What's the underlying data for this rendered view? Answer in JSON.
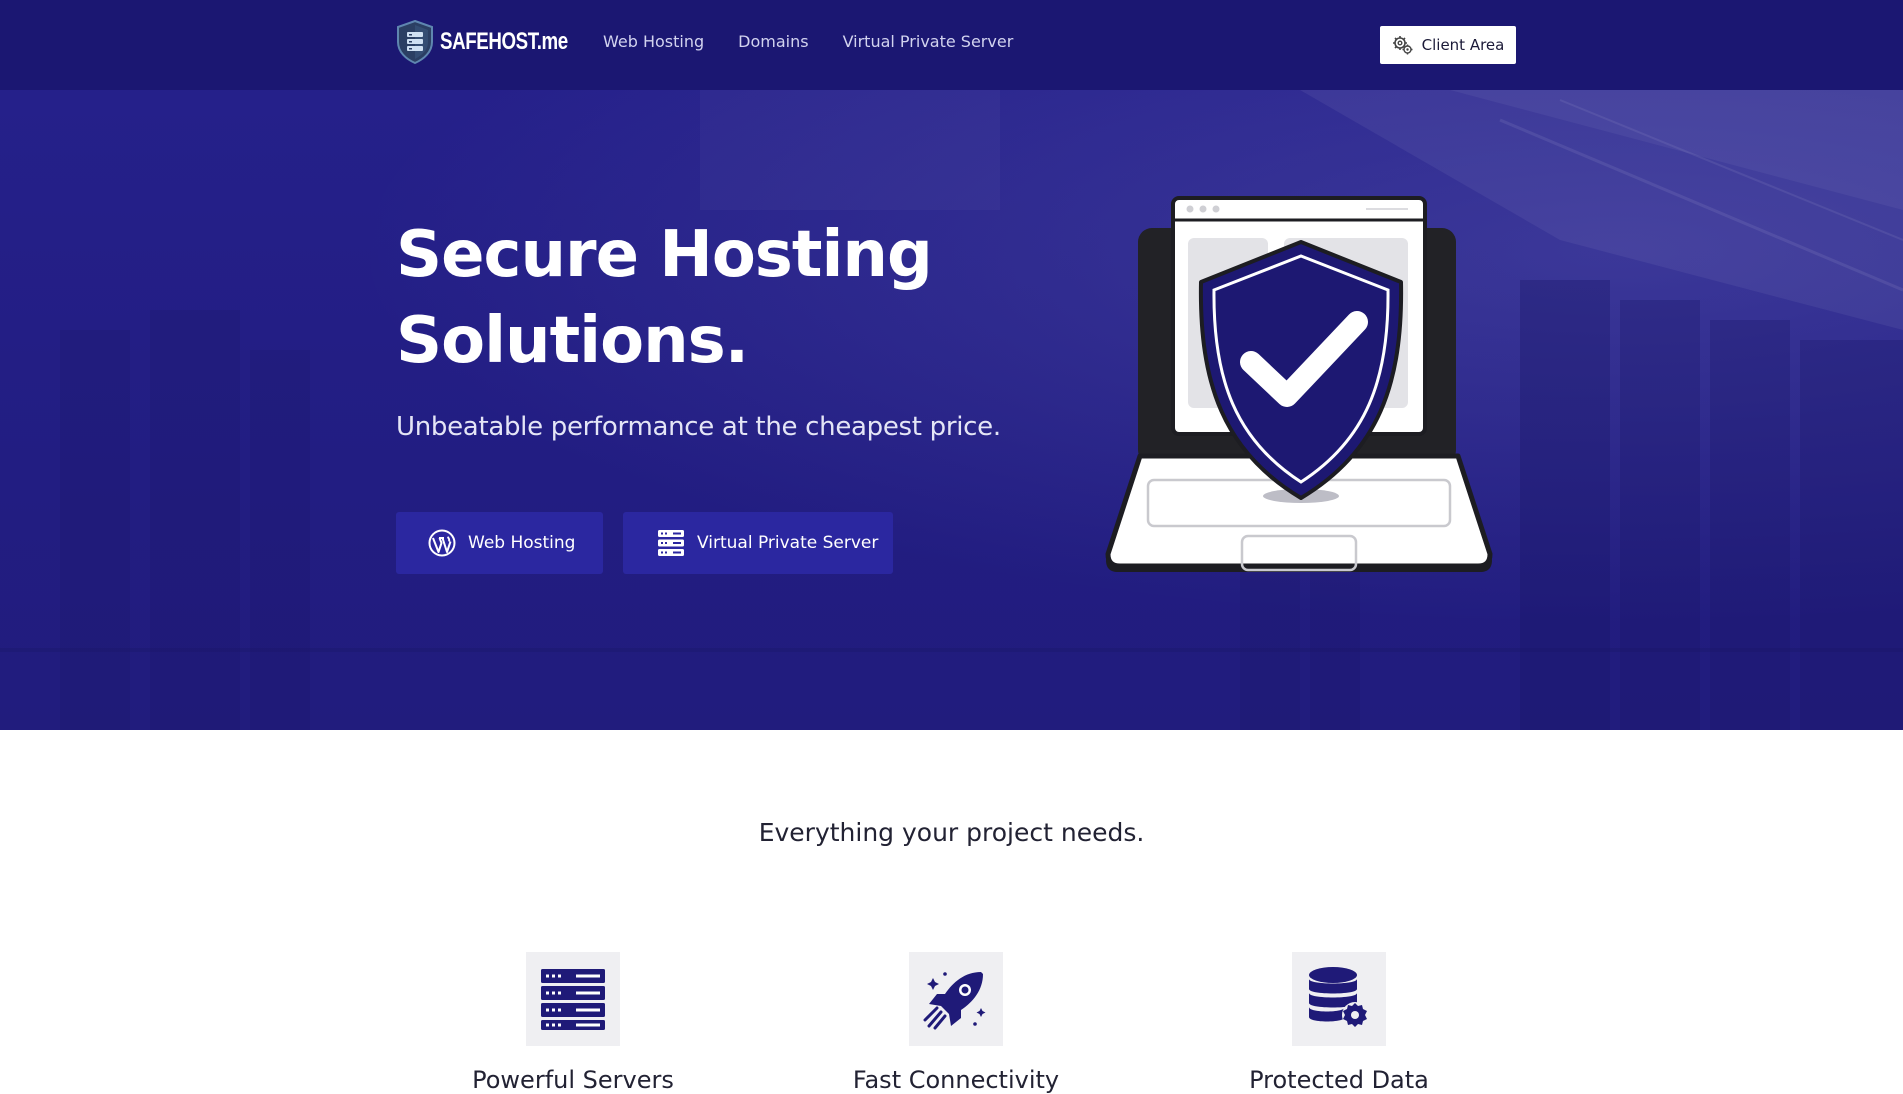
{
  "header": {
    "logo_text": "SAFEHOST.me",
    "nav": [
      {
        "label": "Web Hosting"
      },
      {
        "label": "Domains"
      },
      {
        "label": "Virtual Private Server"
      }
    ],
    "client_area_label": "Client Area",
    "background_color": "#1b1772"
  },
  "hero": {
    "title": "Secure Hosting Solutions.",
    "subtitle": "Unbeatable performance at the cheapest price.",
    "buttons": [
      {
        "label": "Web Hosting",
        "icon": "wordpress-icon"
      },
      {
        "label": "Virtual Private Server",
        "icon": "server-rack-icon"
      }
    ],
    "illustration": "laptop-shield-checkmark",
    "background_color": "#25208a",
    "button_color": "#2b27a0"
  },
  "features": {
    "heading": "Everything your project needs.",
    "items": [
      {
        "title": "Powerful Servers",
        "icon": "server-icon"
      },
      {
        "title": "Fast Connectivity",
        "icon": "rocket-icon"
      },
      {
        "title": "Protected Data",
        "icon": "database-gear-icon"
      }
    ],
    "icon_color": "#1f1a78"
  }
}
